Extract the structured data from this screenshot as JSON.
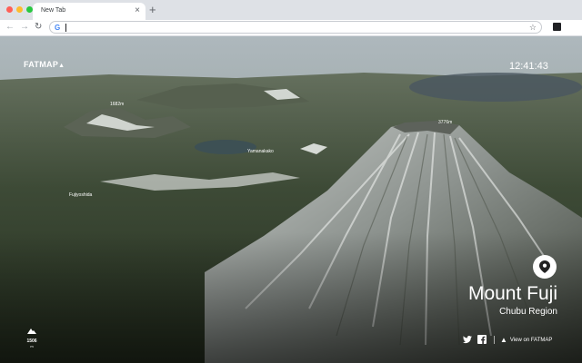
{
  "browser": {
    "tab_title": "New Tab",
    "tab_close": "×",
    "new_tab": "+",
    "omnibox_icon": "G",
    "star_icon": "☆",
    "menu_icon": "⋮"
  },
  "app": {
    "logo": "FATMAP",
    "clock": "12:41:43",
    "place_name": "Mount Fuji",
    "region": "Chubu Region",
    "view_link": "View on FATMAP",
    "elevation": "1506",
    "elevation_unit": "m"
  },
  "map_labels": {
    "peak_nw": "1682m",
    "summit": "3776m",
    "lake_town": "Yamanakako",
    "city": "Fujiyoshida"
  },
  "colors": {
    "accent_red": "#ff5f57",
    "accent_yellow": "#febc2e",
    "accent_green": "#28c840"
  }
}
